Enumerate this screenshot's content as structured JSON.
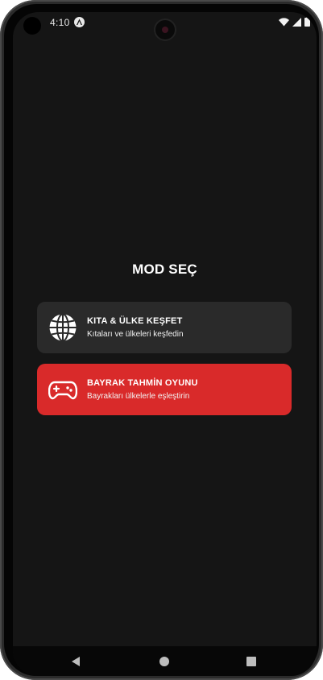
{
  "status_bar": {
    "time": "4:10",
    "app_icon": "expo-icon",
    "icons": [
      "wifi-icon",
      "signal-icon",
      "battery-icon"
    ]
  },
  "page": {
    "title": "MOD SEÇ"
  },
  "modes": [
    {
      "icon": "globe-icon",
      "title": "KITA & ÜLKE KEŞFET",
      "subtitle": "Kıtaları ve ülkeleri keşfedin",
      "background": "#2a2a2a"
    },
    {
      "icon": "gamepad-icon",
      "title": "BAYRAK TAHMİN OYUNU",
      "subtitle": "Bayrakları ülkelerle eşleştirin",
      "background": "#d92a2a"
    }
  ],
  "nav_bar": {
    "buttons": [
      "back-icon",
      "home-icon",
      "recents-icon"
    ]
  },
  "colors": {
    "screen_bg": "#151515",
    "accent": "#d92a2a",
    "card_bg": "#2a2a2a"
  }
}
